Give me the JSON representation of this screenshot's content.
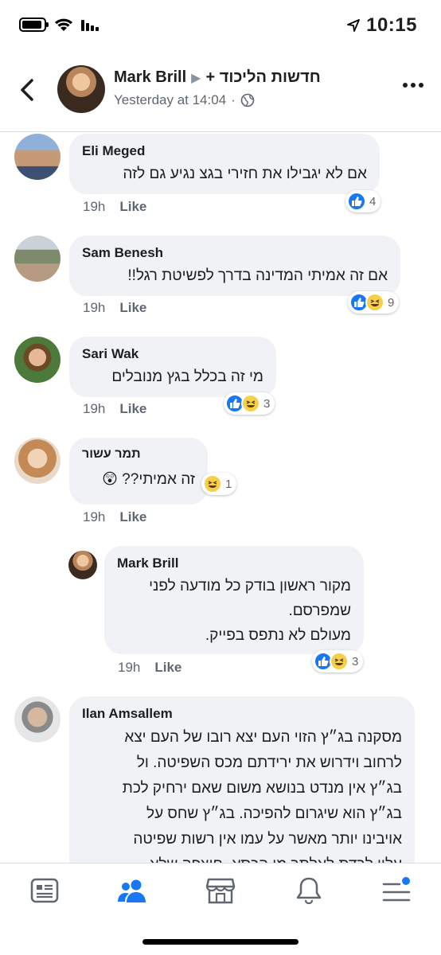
{
  "status_bar": {
    "time": "10:15"
  },
  "header": {
    "author": "Mark Brill",
    "group": "חדשות הליכוד +",
    "timestamp": "Yesterday at 14:04",
    "separator": "·"
  },
  "comments": [
    {
      "name": "Eli Meged",
      "lines": [
        "אם לא יגבילו את חזירי בגצ נגיע גם לזה"
      ],
      "time": "19h",
      "like_label": "Like",
      "reactions": {
        "types": [
          "like"
        ],
        "count": "4"
      }
    },
    {
      "name": "Sam Benesh",
      "lines": [
        "אם זה אמיתי המדינה בדרך לפשיטת רגל!!"
      ],
      "time": "19h",
      "like_label": "Like",
      "reactions": {
        "types": [
          "like",
          "haha"
        ],
        "count": "9"
      }
    },
    {
      "name": "Sari Wak",
      "lines": [
        "מי זה בכלל בגץ  מנובלים"
      ],
      "time": "19h",
      "like_label": "Like",
      "reactions": {
        "types": [
          "like",
          "haha"
        ],
        "count": "3"
      }
    },
    {
      "name": "תמר עשור",
      "lines": [
        "זה אמיתי?? 😲"
      ],
      "time": "19h",
      "like_label": "Like",
      "reactions": {
        "types": [
          "haha"
        ],
        "count": "1"
      }
    },
    {
      "name": "Mark Brill",
      "lines": [
        "מקור ראשון בודק כל מודעה לפני",
        "שמפרסם.",
        "מעולם לא נתפס בפייק."
      ],
      "time": "19h",
      "like_label": "Like",
      "reactions": {
        "types": [
          "like",
          "haha"
        ],
        "count": "3"
      }
    },
    {
      "name": "Ilan Amsallem",
      "lines": [
        "מסקנה בג״ץ הזוי העם יצא רובו של העם יצא",
        "לרחוב וידרוש את ירידתם מכס השפיטה. ול",
        "בג״ץ אין מנדט בנושא משום שאם ירחיק לכת",
        "בג״ץ הוא שיגרום להפיכה. בג״ץ שחס על",
        "אויבינו יותר מאשר על עמו אין רשות שפיטה",
        "עליו לרדת לאלתר מן הכסא. חוצפה שלא"
      ]
    }
  ],
  "nav": {
    "items": [
      "news-feed",
      "groups",
      "marketplace",
      "notifications",
      "menu"
    ],
    "active": "groups",
    "accent": "#1877f2"
  }
}
